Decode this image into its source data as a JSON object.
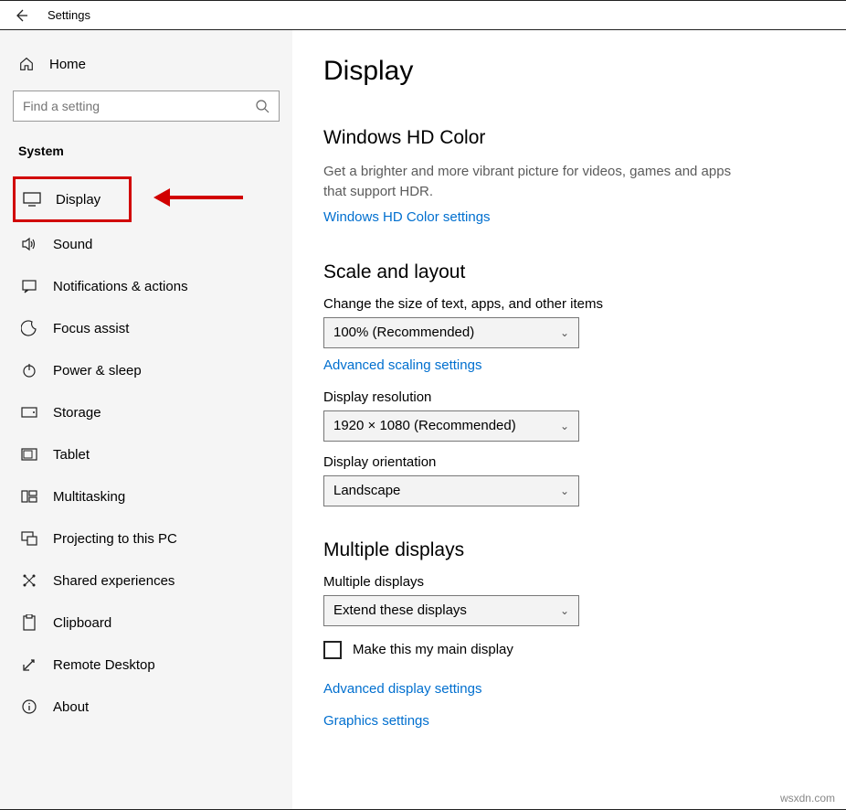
{
  "titlebar": {
    "title": "Settings"
  },
  "sidebar": {
    "home": "Home",
    "search_placeholder": "Find a setting",
    "category": "System",
    "items": [
      {
        "label": "Display"
      },
      {
        "label": "Sound"
      },
      {
        "label": "Notifications & actions"
      },
      {
        "label": "Focus assist"
      },
      {
        "label": "Power & sleep"
      },
      {
        "label": "Storage"
      },
      {
        "label": "Tablet"
      },
      {
        "label": "Multitasking"
      },
      {
        "label": "Projecting to this PC"
      },
      {
        "label": "Shared experiences"
      },
      {
        "label": "Clipboard"
      },
      {
        "label": "Remote Desktop"
      },
      {
        "label": "About"
      }
    ]
  },
  "main": {
    "heading": "Display",
    "hdcolor": {
      "title": "Windows HD Color",
      "desc": "Get a brighter and more vibrant picture for videos, games and apps that support HDR.",
      "link": "Windows HD Color settings"
    },
    "scale": {
      "title": "Scale and layout",
      "size_label": "Change the size of text, apps, and other items",
      "size_value": "100% (Recommended)",
      "adv_link": "Advanced scaling settings",
      "res_label": "Display resolution",
      "res_value": "1920 × 1080 (Recommended)",
      "orient_label": "Display orientation",
      "orient_value": "Landscape"
    },
    "multi": {
      "title": "Multiple displays",
      "label": "Multiple displays",
      "value": "Extend these displays",
      "checkbox": "Make this my main display",
      "adv_link": "Advanced display settings",
      "gfx_link": "Graphics settings"
    }
  },
  "watermark": "wsxdn.com"
}
